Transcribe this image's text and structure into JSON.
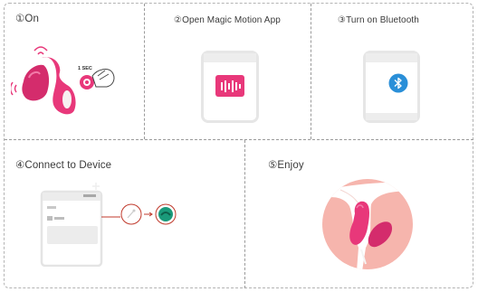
{
  "steps": [
    {
      "label": "①On",
      "icon": "toy-power-icon"
    },
    {
      "label": "②Open Magic Motion App",
      "icon": "app-icon"
    },
    {
      "label": "③Turn on Bluetooth",
      "icon": "bluetooth-icon"
    },
    {
      "label": "④Connect to Device",
      "icon": "connect-device-icon"
    },
    {
      "label": "⑤Enjoy",
      "icon": "enjoy-illustration"
    }
  ],
  "step1_hint": "1 SEC",
  "colors": {
    "pink": "#e8387a",
    "bluetooth": "#2a8fd8",
    "device_green": "#1a9a7a",
    "red_ring": "#c0392b",
    "skin": "#f6b5ad"
  }
}
